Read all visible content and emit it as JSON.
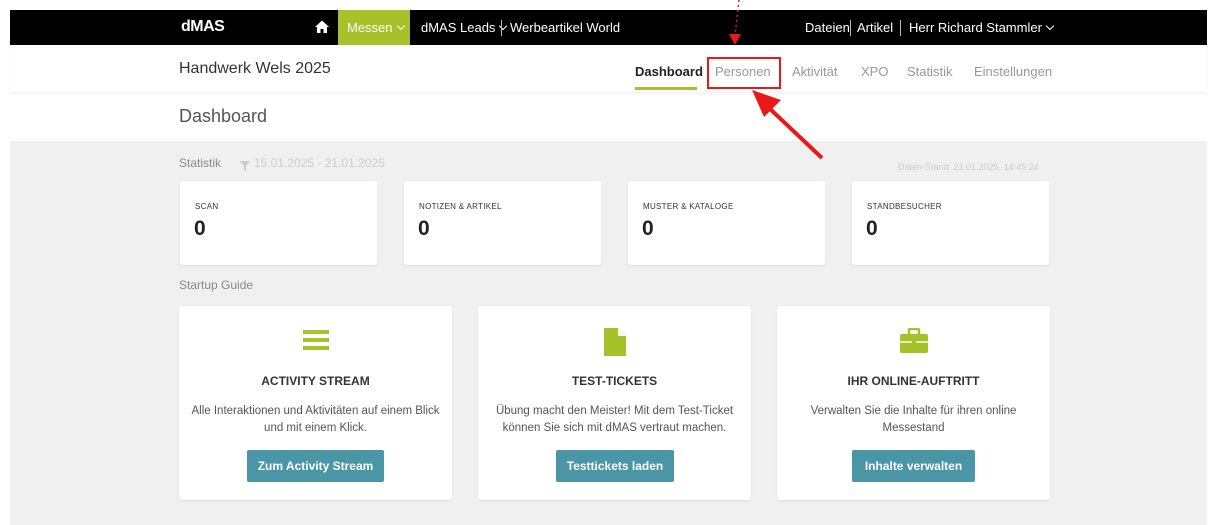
{
  "topbar": {
    "logo": "dMAS",
    "home_icon": "home-icon",
    "messen": "Messen",
    "leads": "dMAS Leads",
    "werbeartikel": "Werbeartikel World",
    "dateien": "Dateien",
    "artikel": "Artikel",
    "user": "Herr Richard Stammler"
  },
  "header": {
    "event_title": "Handwerk Wels 2025",
    "nav": [
      {
        "label": "Dashboard",
        "active": true
      },
      {
        "label": "Personen",
        "active": false
      },
      {
        "label": "Aktivität",
        "active": false
      },
      {
        "label": "XPO",
        "active": false
      },
      {
        "label": "Statistik",
        "active": false
      },
      {
        "label": "Einstellungen",
        "active": false
      }
    ]
  },
  "page_title": "Dashboard",
  "statistik": {
    "label": "Statistik",
    "range": "15.01.2025 - 21.01.2025",
    "stand": "Daten-Stand: 21.01.2025, 14:45:24",
    "kpis": [
      {
        "label": "SCAN",
        "value": "0"
      },
      {
        "label": "NOTIZEN & ARTIKEL",
        "value": "0"
      },
      {
        "label": "MUSTER & KATALOGE",
        "value": "0"
      },
      {
        "label": "STANDBESUCHER",
        "value": "0"
      }
    ]
  },
  "startup": {
    "label": "Startup Guide",
    "cards": [
      {
        "icon": "list-icon",
        "title": "ACTIVITY STREAM",
        "text": "Alle Interaktionen und Aktivitäten auf einem Blick und mit einem Klick.",
        "button": "Zum Activity Stream"
      },
      {
        "icon": "document-icon",
        "title": "TEST-TICKETS",
        "text": "Übung macht den Meister! Mit dem Test-Ticket können Sie sich mit dMAS vertraut machen.",
        "button": "Testtickets laden"
      },
      {
        "icon": "briefcase-icon",
        "title": "IHR ONLINE-AUFTRITT",
        "text": "Verwalten Sie die Inhalte für ihren online Messestand",
        "button": "Inhalte verwalten"
      }
    ]
  },
  "colors": {
    "accent": "#a7c12a",
    "button": "#4a95a6",
    "annotation": "#e81919"
  }
}
